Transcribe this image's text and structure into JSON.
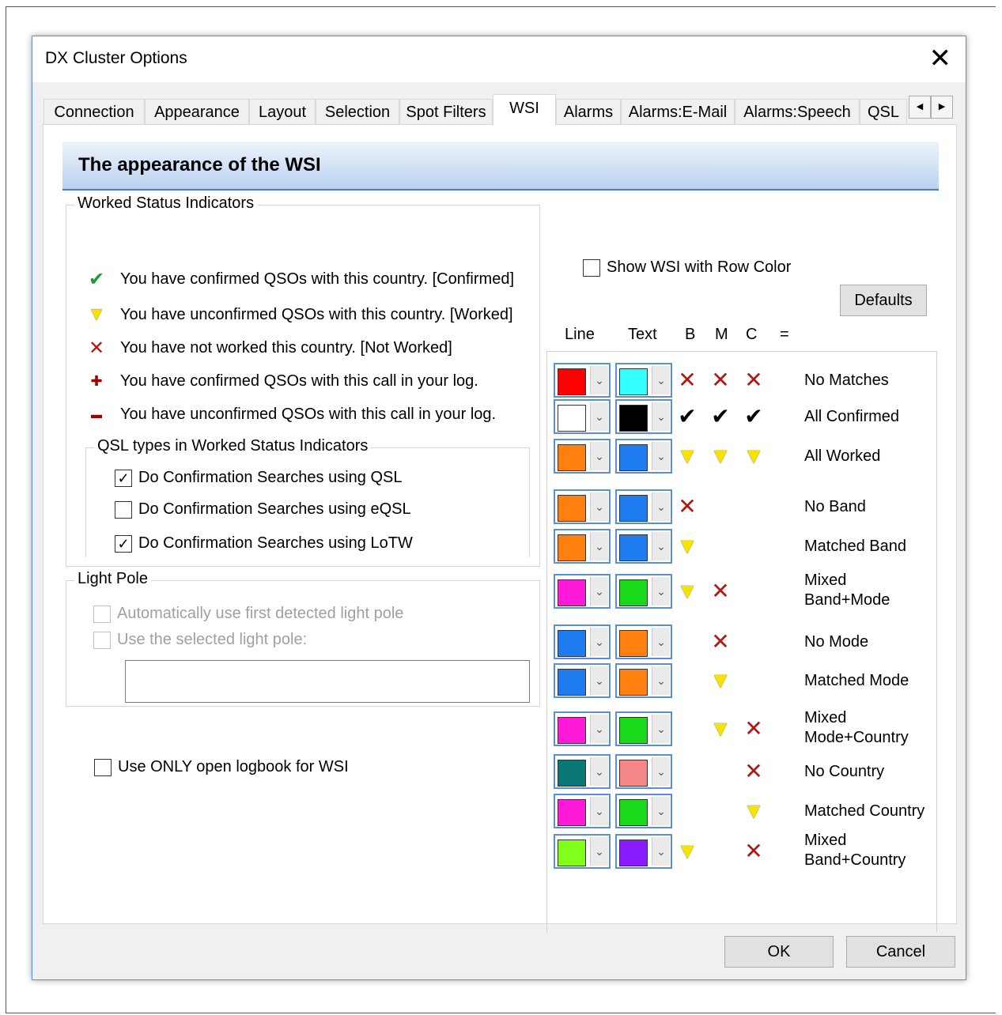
{
  "window": {
    "title": "DX Cluster Options"
  },
  "tabs": [
    "Connection",
    "Appearance",
    "Layout",
    "Selection",
    "Spot Filters",
    "WSI",
    "Alarms",
    "Alarms:E-Mail",
    "Alarms:Speech",
    "QSL"
  ],
  "active_tab": "WSI",
  "banner": "The appearance of the WSI",
  "wsi_group": {
    "label": "Worked Status Indicators",
    "indicators": [
      {
        "icon": "check-icon",
        "text": "You have confirmed QSOs with this country. [Confirmed]"
      },
      {
        "icon": "triangle-icon",
        "text": "You have unconfirmed QSOs with this country. [Worked]"
      },
      {
        "icon": "x-icon",
        "text": "You have not worked this country. [Not Worked]"
      },
      {
        "icon": "plus-icon",
        "text": "You have confirmed QSOs with this call in your log."
      },
      {
        "icon": "minus-icon",
        "text": "You have unconfirmed QSOs with this call in your log."
      }
    ]
  },
  "qsl_group": {
    "label": "QSL types in Worked Status Indicators",
    "options": [
      {
        "label": "Do Confirmation Searches using QSL",
        "checked": true
      },
      {
        "label": "Do Confirmation Searches using eQSL",
        "checked": false
      },
      {
        "label": "Do Confirmation Searches using LoTW",
        "checked": true
      }
    ]
  },
  "light_pole": {
    "label": "Light Pole",
    "auto_label": "Automatically use first detected light pole",
    "selected_label": "Use the selected light pole:",
    "value": ""
  },
  "only_open_logbook": {
    "label": "Use ONLY open logbook for WSI",
    "checked": false
  },
  "show_row_color": {
    "label": "Show WSI with Row Color",
    "checked": false
  },
  "defaults_button": "Defaults",
  "columns": {
    "line": "Line",
    "text": "Text",
    "b": "B",
    "m": "M",
    "c": "C",
    "eq": "="
  },
  "rows": [
    {
      "line": "#ff0000",
      "text": "#33ffff",
      "b": "x",
      "m": "x",
      "c": "x",
      "label": [
        "No Matches"
      ]
    },
    {
      "line": "#ffffff",
      "text": "#000000",
      "b": "check",
      "m": "check",
      "c": "check",
      "label": [
        "All Confirmed"
      ]
    },
    {
      "line": "#ff7f0f",
      "text": "#1e7cf0",
      "b": "tri",
      "m": "tri",
      "c": "tri",
      "label": [
        "All Worked"
      ]
    },
    {
      "line": "#ff7f0f",
      "text": "#1e7cf0",
      "b": "x",
      "m": "",
      "c": "",
      "label": [
        "No Band"
      ]
    },
    {
      "line": "#ff7f0f",
      "text": "#1e7cf0",
      "b": "tri",
      "m": "",
      "c": "",
      "label": [
        "Matched Band"
      ]
    },
    {
      "line": "#ff1ad9",
      "text": "#1ad91a",
      "b": "tri",
      "m": "x",
      "c": "",
      "label": [
        "Mixed",
        "Band+Mode"
      ]
    },
    {
      "line": "#1e7cf0",
      "text": "#ff7f0f",
      "b": "",
      "m": "x",
      "c": "",
      "label": [
        "No Mode"
      ]
    },
    {
      "line": "#1e7cf0",
      "text": "#ff7f0f",
      "b": "",
      "m": "tri",
      "c": "",
      "label": [
        "Matched Mode"
      ]
    },
    {
      "line": "#ff1ad9",
      "text": "#1ad91a",
      "b": "",
      "m": "tri",
      "c": "x",
      "label": [
        "Mixed",
        "Mode+Country"
      ]
    },
    {
      "line": "#0a7777",
      "text": "#f58787",
      "b": "",
      "m": "",
      "c": "x",
      "label": [
        "No Country"
      ]
    },
    {
      "line": "#ff1ad9",
      "text": "#1ad91a",
      "b": "",
      "m": "",
      "c": "tri",
      "label": [
        "Matched Country"
      ]
    },
    {
      "line": "#80ff1a",
      "text": "#8a1aff",
      "b": "tri",
      "m": "",
      "c": "x",
      "label": [
        "Mixed",
        "Band+Country"
      ]
    }
  ],
  "ok_button": "OK",
  "cancel_button": "Cancel"
}
